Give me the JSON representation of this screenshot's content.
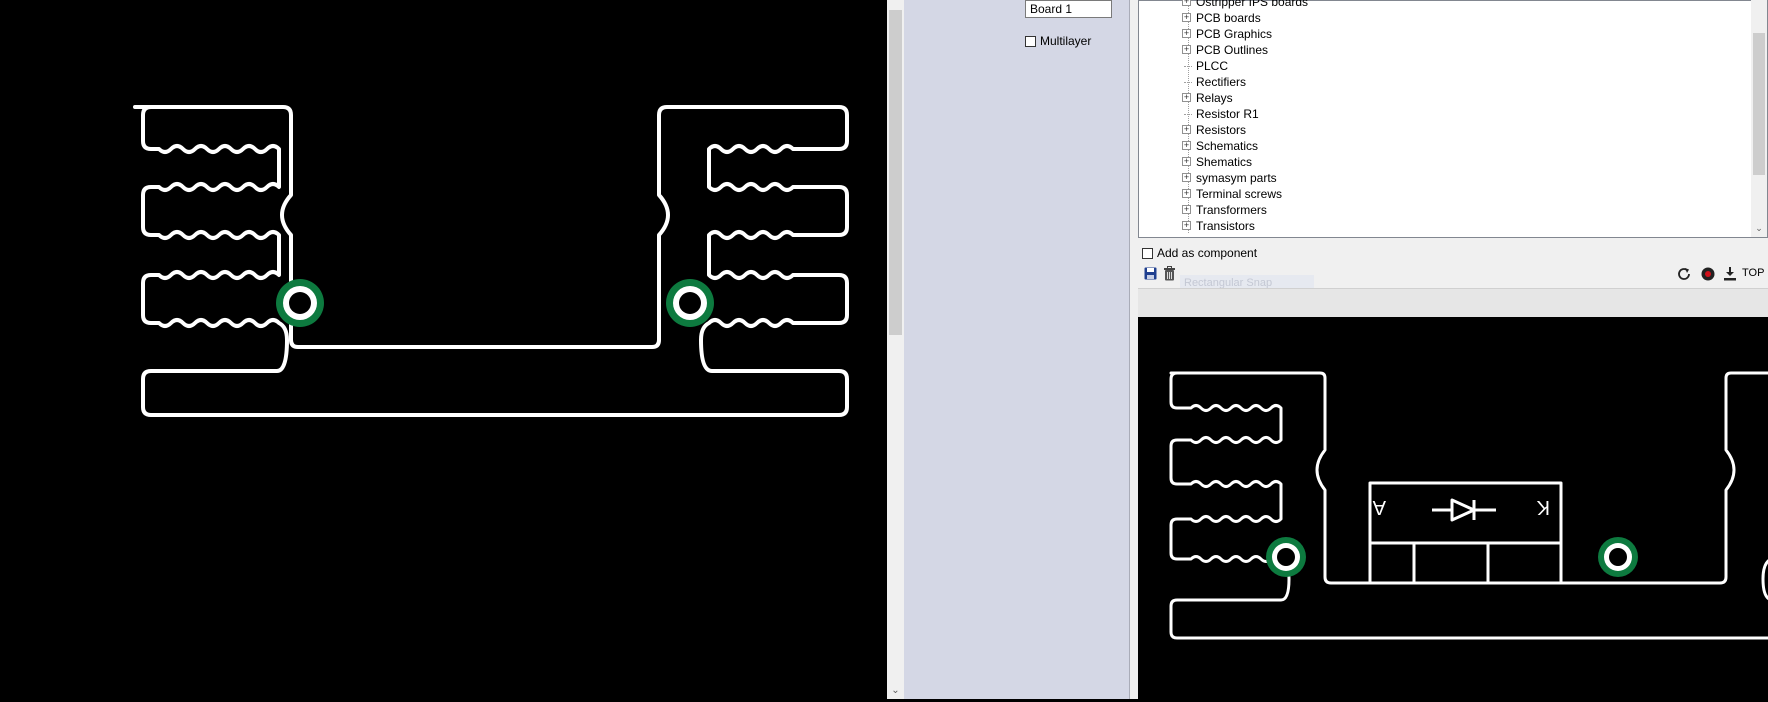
{
  "colors": {
    "canvas_bg": "#000000",
    "trace": "#ffffff",
    "pad_ring": "#0d7a3f",
    "side_panel": "#d4d7e5",
    "lib_panel_bg": "#f0f0f0",
    "tree_bg": "#ffffff"
  },
  "board": {
    "name_value": "Board 1",
    "multilayer_label": "Multilayer",
    "multilayer_checked": false
  },
  "library_tree": {
    "items": [
      {
        "label": "Ostripper IPS boards",
        "expandable": true
      },
      {
        "label": "PCB boards",
        "expandable": true
      },
      {
        "label": "PCB Graphics",
        "expandable": true
      },
      {
        "label": "PCB Outlines",
        "expandable": true
      },
      {
        "label": "PLCC",
        "expandable": false
      },
      {
        "label": "Rectifiers",
        "expandable": false
      },
      {
        "label": "Relays",
        "expandable": true
      },
      {
        "label": "Resistor R1",
        "expandable": false
      },
      {
        "label": "Resistors",
        "expandable": true
      },
      {
        "label": "Schematics",
        "expandable": true
      },
      {
        "label": "Shematics",
        "expandable": true
      },
      {
        "label": "symasym parts",
        "expandable": true
      },
      {
        "label": "Terminal screws",
        "expandable": true
      },
      {
        "label": "Transformers",
        "expandable": true
      },
      {
        "label": "Transistors",
        "expandable": true
      }
    ]
  },
  "add_component": {
    "label": "Add as component",
    "checked": false
  },
  "toolbar": {
    "ghost_label": "Rectangular Snap",
    "layer_label": "TOP",
    "save_icon": "save-icon",
    "trash_icon": "trash-icon",
    "refresh_icon": "refresh-icon",
    "record_icon": "record-icon",
    "import_icon": "import-icon"
  },
  "preview": {
    "anode_label": "A",
    "cathode_label": "K"
  }
}
